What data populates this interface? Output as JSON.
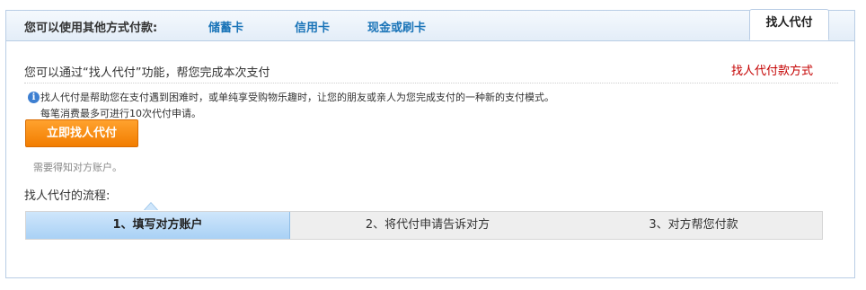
{
  "tabbar": {
    "title": "您可以使用其他方式付款:",
    "tabs": [
      {
        "label": "储蓄卡"
      },
      {
        "label": "信用卡"
      },
      {
        "label": "现金或刷卡"
      }
    ],
    "active_tab": "找人代付"
  },
  "content": {
    "intro": "您可以通过“找人代付”功能，帮您完成本次支付",
    "method_link": "找人代付款方式",
    "info_icon": "info-icon",
    "description_line1": "找人代付是帮助您在支付遇到困难时，或单纯享受购物乐趣时，让您的朋友或亲人为您完成支付的一种新的支付模式。",
    "description_line2": "每笔消费最多可进行10次代付申请。",
    "primary_button": "立即找人代付",
    "note": "需要得知对方账户。",
    "flow_title": "找人代付的流程:",
    "steps": [
      {
        "label": "1、填写对方账户"
      },
      {
        "label": "2、将代付申请告诉对方"
      },
      {
        "label": "3、对方帮您付款"
      }
    ]
  },
  "colors": {
    "accent_blue": "#1a74b8",
    "link_red": "#c40000",
    "button_orange": "#f27d00",
    "active_step": "#a9d1f5"
  }
}
